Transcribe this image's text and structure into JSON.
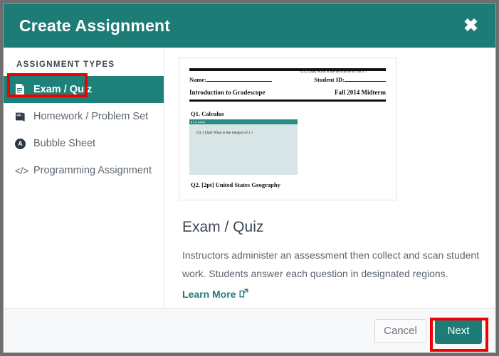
{
  "header": {
    "title": "Create Assignment",
    "close_label": "✖"
  },
  "sidebar": {
    "heading": "ASSIGNMENT TYPES",
    "items": [
      {
        "label": "Exam / Quiz",
        "icon": "document-icon",
        "selected": true
      },
      {
        "label": "Homework / Problem Set",
        "icon": "book-icon",
        "selected": false
      },
      {
        "label": "Bubble Sheet",
        "icon": "bubble-icon",
        "bubble_letter": "A",
        "selected": false
      },
      {
        "label": "Programming Assignment",
        "icon": "code-icon",
        "code_glyph": "</>",
        "selected": false
      }
    ]
  },
  "preview": {
    "name_label": "Name:",
    "student_id_label": "Student ID:",
    "course_title": "Introduction to Gradescope",
    "exam_term": "Fall 2014 Midterm",
    "q1_heading": "Q1.  Calculus",
    "region_bar_label": "■ 1 (2 points)",
    "q1_1": "Q1.1  [3pt] What is the integral of x ?",
    "q1_2": "Q1.2  [3pt]  What is the derivative of  cos x ?",
    "q2_heading": "Q2.  [2pt] United States Geography"
  },
  "detail": {
    "title": "Exam / Quiz",
    "description": "Instructors administer an assessment then collect and scan student work. Students answer each question in designated regions.",
    "learn_more_label": "Learn More"
  },
  "footer": {
    "cancel_label": "Cancel",
    "next_label": "Next"
  },
  "colors": {
    "teal": "#1d7d76",
    "teal_selected": "#1d817a",
    "annotation_red": "#f20000",
    "footer_bg": "#f7f8fa",
    "region_fill": "#d7e5e6",
    "text_gray": "#5c6670"
  }
}
